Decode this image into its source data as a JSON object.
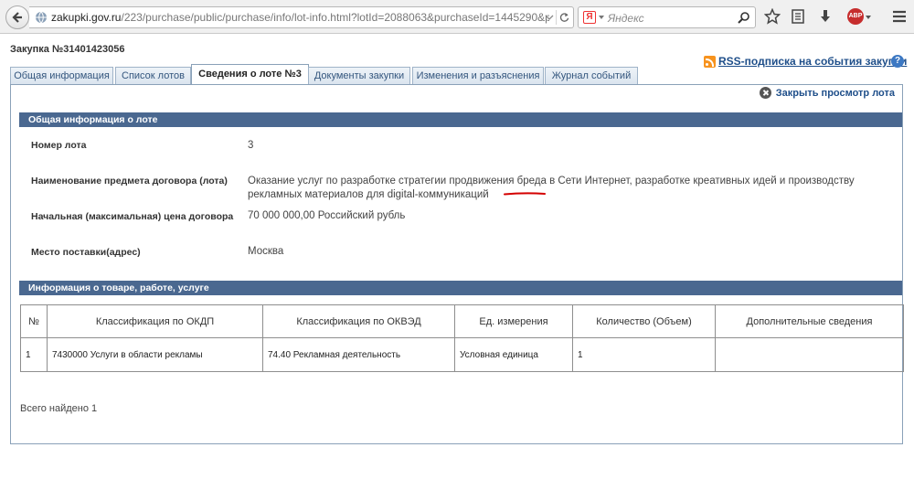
{
  "browser": {
    "url_host": "zakupki.gov.ru",
    "url_path": "/223/purchase/public/purchase/info/lot-info.html?lotId=2088063&purchaseId=1445290&purch",
    "search_placeholder": "Яндекс",
    "search_logo": "Я",
    "abp_label": "ABP"
  },
  "page": {
    "purchase_title": "Закупка №31401423056",
    "rss_link": "RSS-подписка на события закупки",
    "help_label": "?",
    "close_link": "Закрыть просмотр лота",
    "tabs": [
      {
        "label": "Общая информация",
        "active": false
      },
      {
        "label": "Список лотов",
        "active": false
      },
      {
        "label": "Сведения о лоте №3",
        "active": true
      },
      {
        "label": "Документы закупки",
        "active": false
      },
      {
        "label": "Изменения и разъяснения",
        "active": false
      },
      {
        "label": "Журнал событий",
        "active": false
      }
    ]
  },
  "lot_info": {
    "section_title": "Общая информация о лоте",
    "fields": [
      {
        "label": "Номер лота",
        "value": "3"
      },
      {
        "label": "Наименование предмета договора (лота)",
        "value": "Оказание услуг по разработке стратегии продвижения бреда в Сети Интернет, разработке креативных идей и производству рекламных материалов для digital-коммуникаций"
      },
      {
        "label": "Начальная (максимальная) цена договора",
        "value": "70 000 000,00 Российский рубль"
      },
      {
        "label": "Место поставки(адрес)",
        "value": "Москва"
      }
    ]
  },
  "goods": {
    "section_title": "Информация о товаре, работе, услуге",
    "headers": [
      "№",
      "Классификация по ОКДП",
      "Классификация по ОКВЭД",
      "Ед. измерения",
      "Количество (Объем)",
      "Дополнительные сведения"
    ],
    "rows": [
      [
        "1",
        "7430000 Услуги в области рекламы",
        "74.40 Рекламная деятельность",
        "Условная единица",
        "1",
        ""
      ]
    ],
    "total": "Всего найдено 1"
  },
  "colors": {
    "section_bar": "#4a6890",
    "link": "#1f4f8a",
    "annotation": "#d40000"
  }
}
